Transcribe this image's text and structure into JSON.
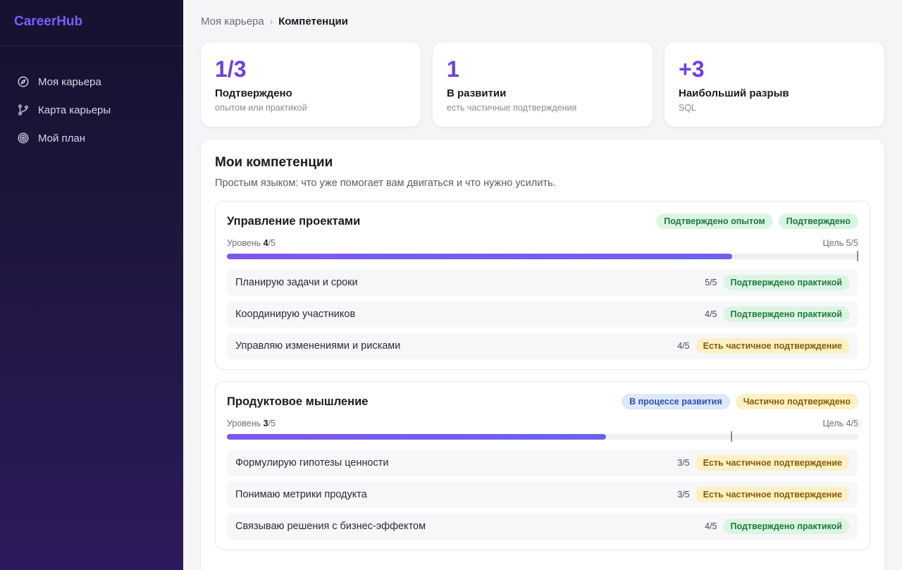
{
  "app": {
    "brand": "CareerHub"
  },
  "sidebar": {
    "items": [
      {
        "label": "Моя карьера",
        "icon": "compass-icon"
      },
      {
        "label": "Карта карьеры",
        "icon": "git-branch-icon"
      },
      {
        "label": "Мой план",
        "icon": "target-icon"
      }
    ]
  },
  "breadcrumb": {
    "parent": "Моя карьера",
    "current": "Компетенции"
  },
  "stats": [
    {
      "value": "1/3",
      "label": "Подтверждено",
      "sub": "опытом или практикой"
    },
    {
      "value": "1",
      "label": "В развитии",
      "sub": "есть частичные подтверждения"
    },
    {
      "value": "+3",
      "label": "Наибольший разрыв",
      "sub": "SQL"
    }
  ],
  "panel": {
    "title": "Мои компетенции",
    "subtitle": "Простым языком: что уже помогает вам двигаться и что нужно усилить."
  },
  "competencies": [
    {
      "title": "Управление проектами",
      "badges": [
        {
          "label": "Подтверждено опытом",
          "tone": "green"
        },
        {
          "label": "Подтверждено",
          "tone": "green"
        }
      ],
      "level_prefix": "Уровень ",
      "level": "4",
      "level_suffix": "/5",
      "level_fraction": 0.8,
      "goal_text": "Цель 5/5",
      "goal_fraction": 1.0,
      "skills": [
        {
          "name": "Планирую задачи и сроки",
          "score": "5/5",
          "status": "Подтверждено практикой",
          "tone": "green"
        },
        {
          "name": "Координирую участников",
          "score": "4/5",
          "status": "Подтверждено практикой",
          "tone": "green"
        },
        {
          "name": "Управляю изменениями и рисками",
          "score": "4/5",
          "status": "Есть частичное подтверждение",
          "tone": "yellow"
        }
      ]
    },
    {
      "title": "Продуктовое мышление",
      "badges": [
        {
          "label": "В процессе развития",
          "tone": "blue"
        },
        {
          "label": "Частично подтверждено",
          "tone": "yellow"
        }
      ],
      "level_prefix": "Уровень ",
      "level": "3",
      "level_suffix": "/5",
      "level_fraction": 0.6,
      "goal_text": "Цель 4/5",
      "goal_fraction": 0.8,
      "skills": [
        {
          "name": "Формулирую гипотезы ценности",
          "score": "3/5",
          "status": "Есть частичное подтверждение",
          "tone": "yellow"
        },
        {
          "name": "Понимаю метрики продукта",
          "score": "3/5",
          "status": "Есть частичное подтверждение",
          "tone": "yellow"
        },
        {
          "name": "Связываю решения с бизнес-эффектом",
          "score": "4/5",
          "status": "Подтверждено практикой",
          "tone": "green"
        }
      ]
    }
  ],
  "colors": {
    "accent": "#6d3fe6",
    "brand": "#7b5cff"
  }
}
